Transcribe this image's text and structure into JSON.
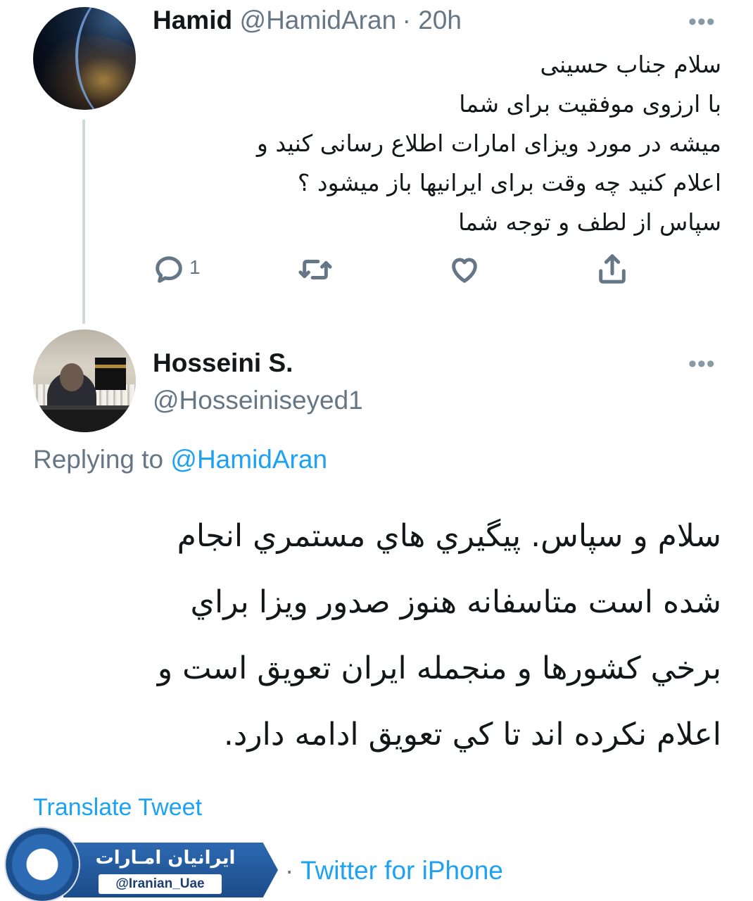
{
  "tweet1": {
    "name": "Hamid",
    "handle": "@HamidAran",
    "time": "· 20h",
    "more": "•••",
    "lines": [
      "سلام جناب حسینی",
      "با ارزوی موفقیت برای شما",
      "میشه در مورد ویزای امارات اطلاع رسانی کنید و",
      "اعلام کنید چه وقت برای ایرانیها باز میشود ؟",
      "سپاس از لطف و توجه شما"
    ],
    "reply_count": "1",
    "icons": [
      "reply-icon",
      "retweet-icon",
      "like-icon",
      "share-icon"
    ]
  },
  "tweet2": {
    "name": "Hosseini S.",
    "handle": "@Hosseiniseyed1",
    "more": "•••",
    "replying_prefix": "Replying to ",
    "replying_handle": "@HamidAran",
    "lines": [
      "سلام و سپاس. پیگیري هاي مستمري انجام",
      "شده است متاسفانه هنوز صدور ویزا براي",
      "برخي کشورها و منجمله ایران تعویق است و",
      "اعلام نکرده اند تا کي تعویق ادامه دارد."
    ],
    "translate": "Translate Tweet",
    "source_sep": "· ",
    "source": "Twitter for iPhone"
  },
  "watermark": {
    "title": "ایرانیان امـارات",
    "handle": "@Iranian_Uae"
  },
  "colors": {
    "link": "#1da1f2",
    "muted": "#657786",
    "text": "#14171a",
    "thread_line": "#cfd9de"
  }
}
